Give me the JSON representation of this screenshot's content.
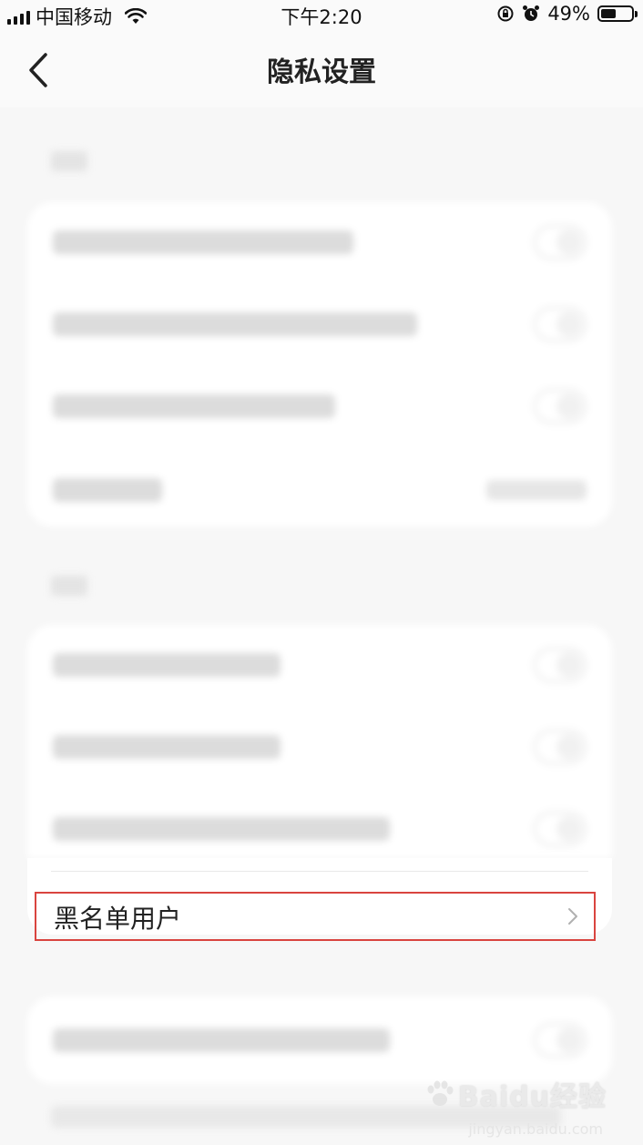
{
  "status_bar": {
    "carrier": "中国移动",
    "time": "下午2:20",
    "battery_percent": "49%",
    "battery_level": 0.49,
    "icons": [
      "signal-icon",
      "wifi-icon",
      "rotation-lock-icon",
      "alarm-icon",
      "battery-icon"
    ]
  },
  "nav": {
    "title": "隐私设置",
    "back_icon": "chevron-left-icon"
  },
  "blacklist": {
    "label": "黑名单用户",
    "icon": "chevron-right-icon"
  },
  "watermark": {
    "brand": "Baidu经验",
    "sub": "jingyan.baidu.com"
  },
  "colors": {
    "highlight_border": "#d9443f",
    "background": "#f7f7f7",
    "card": "#ffffff"
  }
}
